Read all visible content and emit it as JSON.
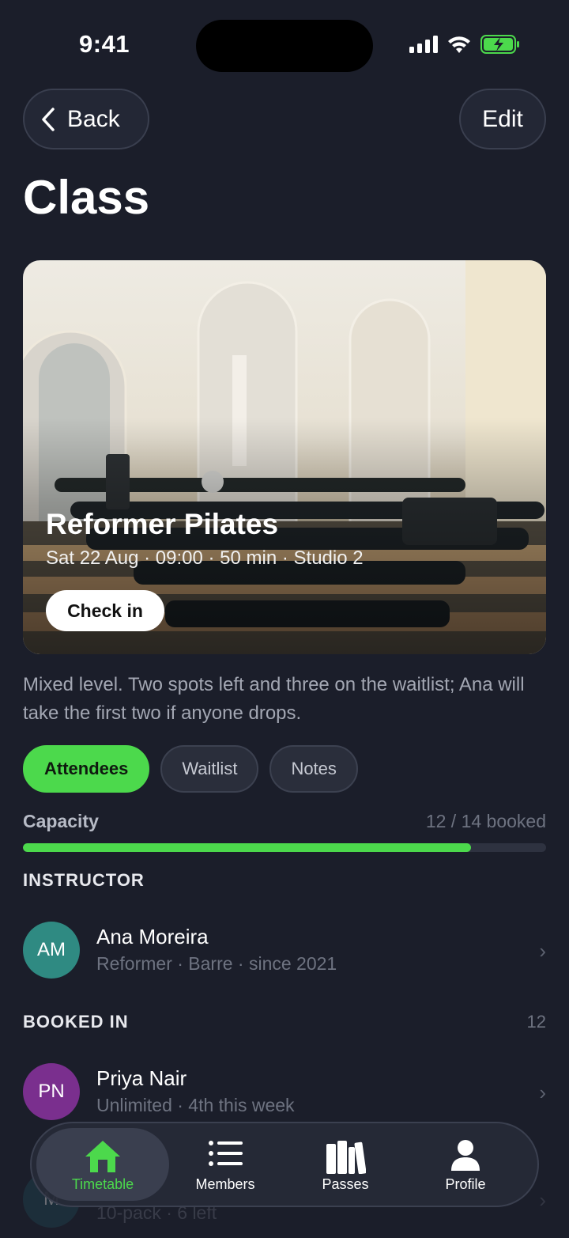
{
  "status_bar": {
    "time": "9:41"
  },
  "nav": {
    "back_label": "Back",
    "edit_label": "Edit"
  },
  "page": {
    "title": "Class"
  },
  "class": {
    "name": "Reformer Pilates",
    "meta": "Sat 22 Aug · 09:00 · 50 min · Studio 2",
    "checkin_label": "Check in",
    "description": "Mixed level. Two spots left and three on the waitlist; Ana will take the first two if anyone drops."
  },
  "tabs": [
    {
      "label": "Attendees",
      "active": true
    },
    {
      "label": "Waitlist",
      "active": false
    },
    {
      "label": "Notes",
      "active": false
    }
  ],
  "capacity": {
    "label": "Capacity",
    "value_text": "12 / 14 booked",
    "booked": 12,
    "total": 14
  },
  "instructor_section": {
    "heading": "INSTRUCTOR",
    "person": {
      "initials": "AM",
      "name": "Ana Moreira",
      "sub": "Reformer · Barre · since 2021",
      "avatar_color": "#2f8a82"
    }
  },
  "booked_section": {
    "heading": "BOOKED IN",
    "count": "12",
    "people": [
      {
        "initials": "PN",
        "name": "Priya Nair",
        "sub": "Unlimited · 4th this week",
        "avatar_color": "#7a2f8e"
      },
      {
        "initials": "M",
        "name": "",
        "sub": "10-pack · 6 left",
        "avatar_color": "#1f4e5a"
      }
    ]
  },
  "tabbar": [
    {
      "label": "Timetable",
      "icon": "home-icon",
      "active": true
    },
    {
      "label": "Members",
      "icon": "list-icon",
      "active": false
    },
    {
      "label": "Passes",
      "icon": "books-icon",
      "active": false
    },
    {
      "label": "Profile",
      "icon": "person-icon",
      "active": false
    }
  ],
  "colors": {
    "accent": "#4cd94c",
    "background": "#1b1e2a"
  }
}
